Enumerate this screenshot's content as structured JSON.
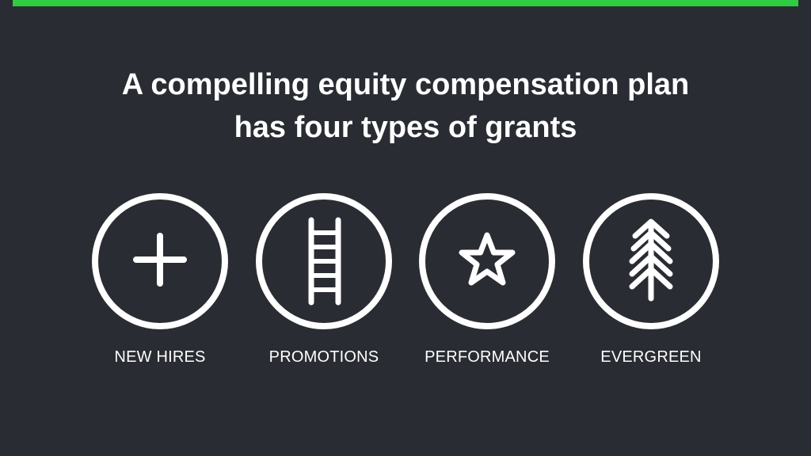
{
  "colors": {
    "background": "#2a2c33",
    "accent_bar": "#2ecc40",
    "foreground": "#ffffff"
  },
  "title": {
    "line1": "A compelling equity compensation plan",
    "line2": "has four types of grants"
  },
  "grants": [
    {
      "icon": "plus-icon",
      "label": "NEW HIRES"
    },
    {
      "icon": "ladder-icon",
      "label": "PROMOTIONS"
    },
    {
      "icon": "star-icon",
      "label": "PERFORMANCE"
    },
    {
      "icon": "evergreen-tree-icon",
      "label": "EVERGREEN"
    }
  ]
}
